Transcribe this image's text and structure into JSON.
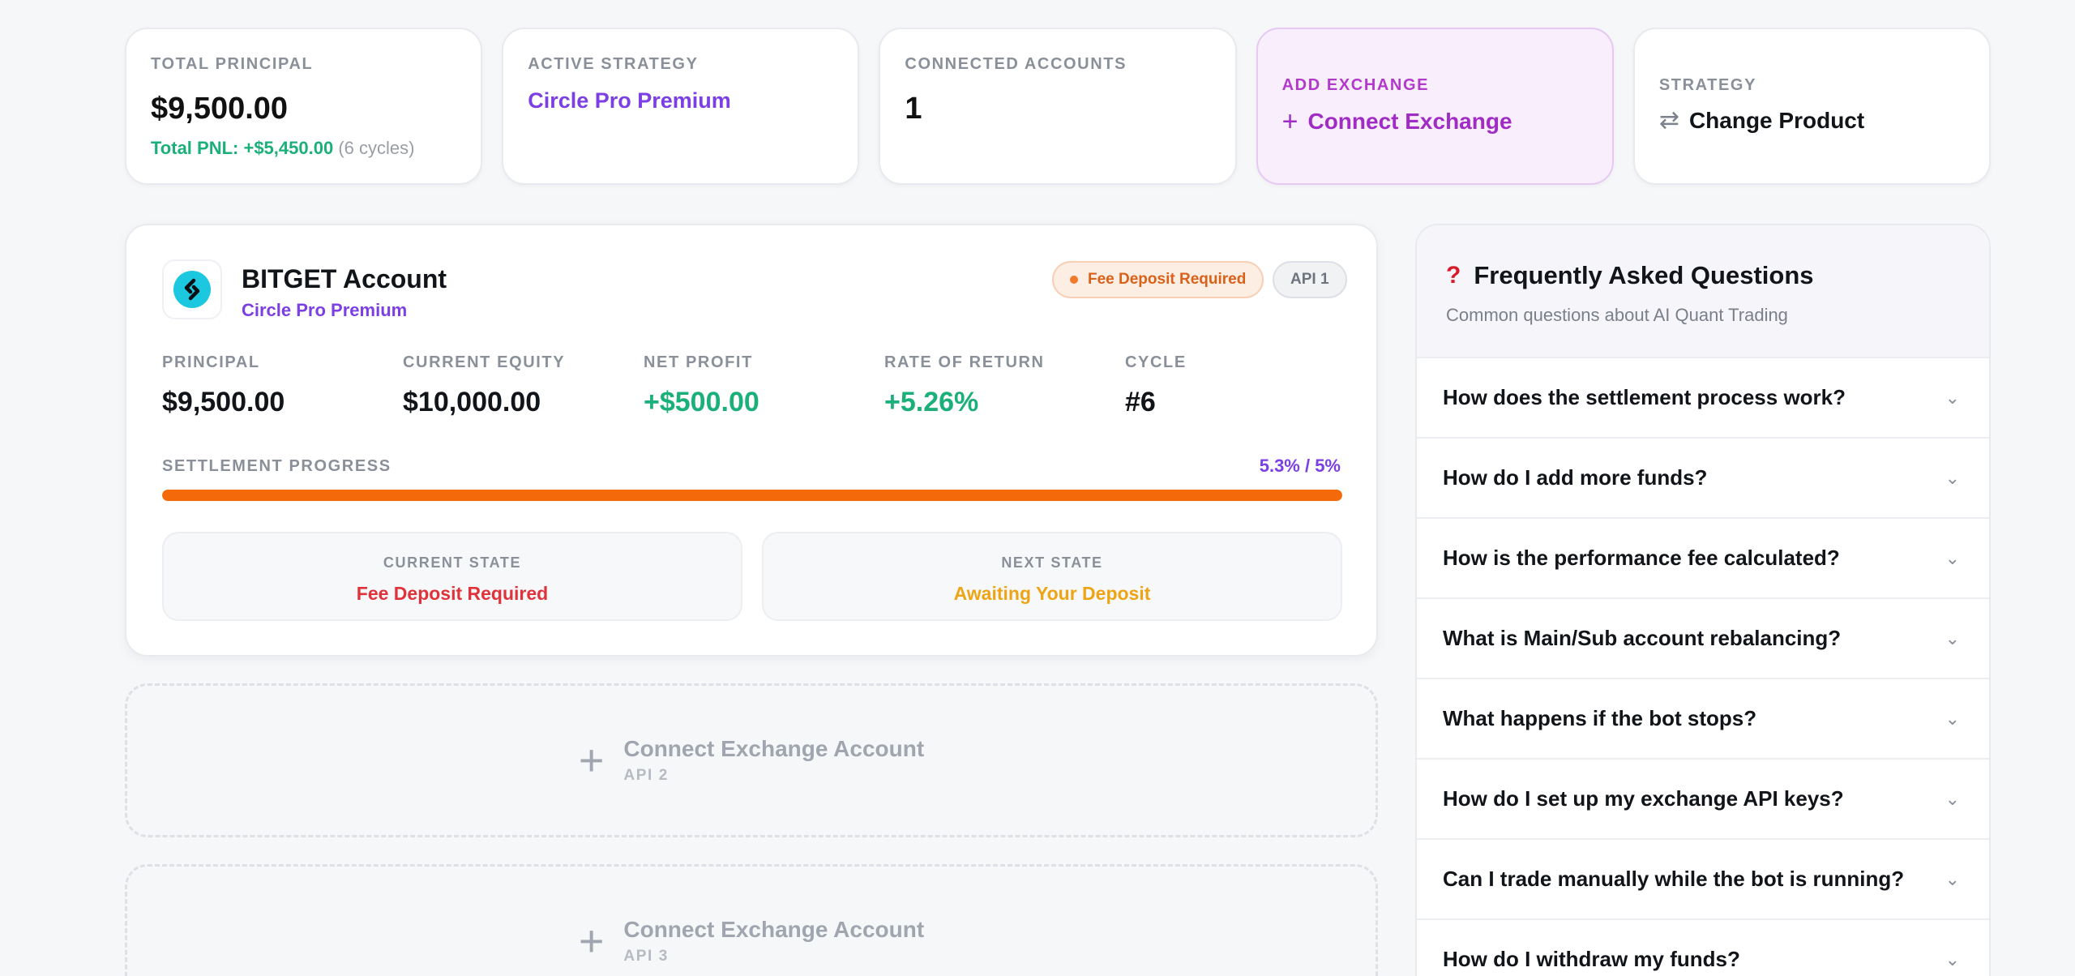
{
  "stats": {
    "principal": {
      "label": "TOTAL PRINCIPAL",
      "value": "$9,500.00",
      "pnl_label": "Total PNL: +$5,450.00",
      "pnl_suffix": "(6 cycles)"
    },
    "strategy_active": {
      "label": "ACTIVE STRATEGY",
      "value": "Circle Pro Premium"
    },
    "accounts": {
      "label": "CONNECTED ACCOUNTS",
      "value": "1"
    },
    "add_exchange": {
      "label": "ADD EXCHANGE",
      "action": "Connect Exchange",
      "icon": "plus-icon"
    },
    "strategy": {
      "label": "STRATEGY",
      "action": "Change Product",
      "icon": "swap-icon"
    }
  },
  "account": {
    "title": "BITGET Account",
    "subtitle": "Circle Pro Premium",
    "badge_status": "Fee Deposit Required",
    "badge_api": "API 1",
    "metrics": [
      {
        "label": "PRINCIPAL",
        "value": "$9,500.00"
      },
      {
        "label": "CURRENT EQUITY",
        "value": "$10,000.00"
      },
      {
        "label": "NET PROFIT",
        "value": "+$500.00"
      },
      {
        "label": "RATE OF RETURN",
        "value": "+5.26%"
      },
      {
        "label": "CYCLE",
        "value": "#6"
      }
    ],
    "progress": {
      "label": "SETTLEMENT PROGRESS",
      "value_text": "5.3% / 5%",
      "fraction": 1.0
    },
    "current_state": {
      "label": "CURRENT STATE",
      "value": "Fee Deposit Required"
    },
    "next_state": {
      "label": "NEXT STATE",
      "value": "Awaiting Your Deposit"
    }
  },
  "slots": [
    {
      "title": "Connect Exchange Account",
      "sub": "API 2"
    },
    {
      "title": "Connect Exchange Account",
      "sub": "API 3"
    }
  ],
  "faq": {
    "title": "Frequently Asked Questions",
    "subtitle": "Common questions about AI Quant Trading",
    "items": [
      "How does the settlement process work?",
      "How do I add more funds?",
      "How is the performance fee calculated?",
      "What is Main/Sub account rebalancing?",
      "What happens if the bot stops?",
      "How do I set up my exchange API keys?",
      "Can I trade manually while the bot is running?",
      "How do I withdraw my funds?"
    ]
  },
  "colors": {
    "accent_purple": "#7b3fe4",
    "green": "#1bb07a",
    "orange": "#f46a0a",
    "red": "#e0323a",
    "amber": "#eea515"
  }
}
